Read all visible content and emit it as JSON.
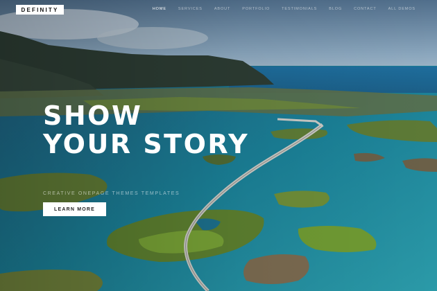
{
  "brand": {
    "logo_text": "DEFINITY"
  },
  "nav": {
    "items": [
      {
        "label": "HOME",
        "active": true
      },
      {
        "label": "SERVICES",
        "active": false
      },
      {
        "label": "ABOUT",
        "active": false
      },
      {
        "label": "PORTFOLIO",
        "active": false
      },
      {
        "label": "TESTIMONIALS",
        "active": false
      },
      {
        "label": "BLOG",
        "active": false
      },
      {
        "label": "CONTACT",
        "active": false
      },
      {
        "label": "ALL DEMOS",
        "active": false
      }
    ]
  },
  "hero": {
    "title": "SHOW\nYOUR STORY",
    "subtitle": "CREATIVE ONEPAGE THEMES TEMPLATES",
    "cta_label": "LEARN MORE"
  },
  "colors": {
    "sea": "#1f6f86",
    "sky": "#6f8fa8",
    "land": "#6e8a3a",
    "cta_bg": "#ffffff"
  }
}
